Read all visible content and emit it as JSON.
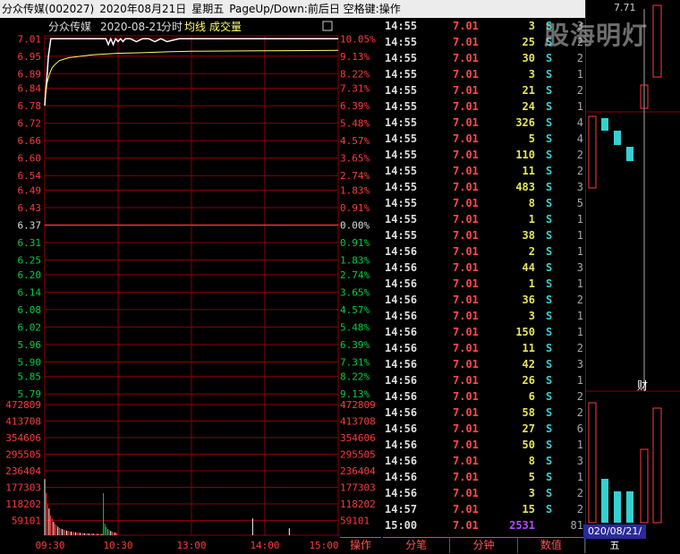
{
  "title_bar": {
    "stock": "分众传媒(002027)",
    "date": "2020年08月21日",
    "weekday": "星期五",
    "hint": "PageUp/Down:前后日 空格键:操作"
  },
  "chart_header": {
    "name": "分众传媒",
    "date": "2020-08-21",
    "mode": "分时",
    "avg_label": "均线",
    "vol_label": "成交量"
  },
  "chart_data": {
    "type": "line",
    "prev_close": 6.37,
    "price_ticks": [
      "7.01",
      "6.95",
      "6.89",
      "6.84",
      "6.78",
      "6.72",
      "6.66",
      "6.60",
      "6.54",
      "6.49",
      "6.43",
      "6.37",
      "6.31",
      "6.25",
      "6.20",
      "6.14",
      "6.08",
      "6.02",
      "5.96",
      "5.90",
      "5.85",
      "5.79"
    ],
    "pct_ticks": [
      "10.05%",
      "9.13%",
      "8.22%",
      "7.31%",
      "6.39%",
      "5.48%",
      "4.57%",
      "3.65%",
      "2.74%",
      "1.83%",
      "0.91%",
      "0.00%",
      "0.91%",
      "1.83%",
      "2.74%",
      "3.65%",
      "4.57%",
      "5.48%",
      "6.39%",
      "7.31%",
      "8.22%",
      "9.13%"
    ],
    "ylim": [
      5.76,
      7.02
    ],
    "price_series": {
      "x": [
        0,
        1,
        2,
        3,
        5,
        8,
        10,
        15,
        20,
        25,
        30,
        35,
        40,
        45,
        50,
        52,
        54,
        56,
        58,
        60,
        62,
        64,
        66,
        68,
        70,
        75,
        80,
        85,
        90,
        95,
        100,
        110,
        120,
        130,
        140,
        150,
        160,
        170,
        180,
        190,
        200,
        210,
        220,
        230,
        240
      ],
      "values": [
        6.78,
        6.84,
        6.89,
        6.95,
        7.01,
        7.01,
        7.01,
        7.01,
        7.01,
        7.01,
        7.01,
        7.01,
        7.01,
        7.01,
        7.01,
        6.99,
        7.01,
        6.99,
        7.01,
        7.0,
        7.01,
        7.0,
        7.01,
        7.01,
        7.01,
        7.0,
        7.01,
        7.01,
        7.0,
        7.01,
        7.0,
        7.01,
        7.01,
        7.01,
        7.01,
        7.01,
        7.01,
        7.01,
        7.01,
        7.01,
        7.01,
        7.01,
        7.01,
        7.01,
        7.01
      ]
    },
    "avg_series": {
      "x": [
        0,
        2,
        4,
        6,
        8,
        12,
        16,
        20,
        30,
        40,
        60,
        80,
        100,
        120,
        160,
        200,
        240
      ],
      "values": [
        6.8,
        6.86,
        6.89,
        6.91,
        6.92,
        6.935,
        6.94,
        6.945,
        6.95,
        6.955,
        6.96,
        6.962,
        6.965,
        6.967,
        6.968,
        6.969,
        6.97
      ]
    },
    "volume_ticks": [
      "472809",
      "413708",
      "354606",
      "295505",
      "236404",
      "177303",
      "118202",
      "59101"
    ],
    "volume_max": 472809,
    "volumes": [
      200000,
      150000,
      110000,
      95000,
      70000,
      60000,
      48000,
      40000,
      35000,
      30000,
      26000,
      24000,
      22000,
      20000,
      18000,
      16000,
      15000,
      14000,
      13000,
      12000,
      11000,
      10000,
      9500,
      9000,
      8500,
      8000,
      7500,
      7000,
      6800,
      6500,
      6200,
      6000,
      5800,
      5600,
      5400,
      5200,
      5000,
      4800,
      4600,
      4400,
      150000,
      40000,
      30000,
      22000,
      18000,
      15000,
      12000,
      10000,
      9000,
      8000
    ],
    "time_labels": [
      "09:30",
      "10:30",
      "13:00",
      "14:00",
      "15:00"
    ]
  },
  "ticks": [
    {
      "t": "14:55",
      "p": "7.01",
      "v": "3",
      "bs": "S",
      "n": "3"
    },
    {
      "t": "14:55",
      "p": "7.01",
      "v": "25",
      "bs": "S",
      "n": "2"
    },
    {
      "t": "14:55",
      "p": "7.01",
      "v": "30",
      "bs": "S",
      "n": "2"
    },
    {
      "t": "14:55",
      "p": "7.01",
      "v": "3",
      "bs": "S",
      "n": "1"
    },
    {
      "t": "14:55",
      "p": "7.01",
      "v": "21",
      "bs": "S",
      "n": "2"
    },
    {
      "t": "14:55",
      "p": "7.01",
      "v": "24",
      "bs": "S",
      "n": "1"
    },
    {
      "t": "14:55",
      "p": "7.01",
      "v": "326",
      "bs": "S",
      "n": "4"
    },
    {
      "t": "14:55",
      "p": "7.01",
      "v": "5",
      "bs": "S",
      "n": "4"
    },
    {
      "t": "14:55",
      "p": "7.01",
      "v": "110",
      "bs": "S",
      "n": "2"
    },
    {
      "t": "14:55",
      "p": "7.01",
      "v": "11",
      "bs": "S",
      "n": "2"
    },
    {
      "t": "14:55",
      "p": "7.01",
      "v": "483",
      "bs": "S",
      "n": "3"
    },
    {
      "t": "14:55",
      "p": "7.01",
      "v": "8",
      "bs": "S",
      "n": "5"
    },
    {
      "t": "14:55",
      "p": "7.01",
      "v": "1",
      "bs": "S",
      "n": "1"
    },
    {
      "t": "14:55",
      "p": "7.01",
      "v": "38",
      "bs": "S",
      "n": "1"
    },
    {
      "t": "14:56",
      "p": "7.01",
      "v": "2",
      "bs": "S",
      "n": "1"
    },
    {
      "t": "14:56",
      "p": "7.01",
      "v": "44",
      "bs": "S",
      "n": "3"
    },
    {
      "t": "14:56",
      "p": "7.01",
      "v": "1",
      "bs": "S",
      "n": "1"
    },
    {
      "t": "14:56",
      "p": "7.01",
      "v": "36",
      "bs": "S",
      "n": "2"
    },
    {
      "t": "14:56",
      "p": "7.01",
      "v": "3",
      "bs": "S",
      "n": "1"
    },
    {
      "t": "14:56",
      "p": "7.01",
      "v": "150",
      "bs": "S",
      "n": "1"
    },
    {
      "t": "14:56",
      "p": "7.01",
      "v": "11",
      "bs": "S",
      "n": "2"
    },
    {
      "t": "14:56",
      "p": "7.01",
      "v": "42",
      "bs": "S",
      "n": "3"
    },
    {
      "t": "14:56",
      "p": "7.01",
      "v": "26",
      "bs": "S",
      "n": "1"
    },
    {
      "t": "14:56",
      "p": "7.01",
      "v": "6",
      "bs": "S",
      "n": "2"
    },
    {
      "t": "14:56",
      "p": "7.01",
      "v": "58",
      "bs": "S",
      "n": "2"
    },
    {
      "t": "14:56",
      "p": "7.01",
      "v": "27",
      "bs": "S",
      "n": "6"
    },
    {
      "t": "14:56",
      "p": "7.01",
      "v": "50",
      "bs": "S",
      "n": "1"
    },
    {
      "t": "14:56",
      "p": "7.01",
      "v": "8",
      "bs": "S",
      "n": "3"
    },
    {
      "t": "14:56",
      "p": "7.01",
      "v": "5",
      "bs": "S",
      "n": "1"
    },
    {
      "t": "14:56",
      "p": "7.01",
      "v": "3",
      "bs": "S",
      "n": "2"
    },
    {
      "t": "14:57",
      "p": "7.01",
      "v": "15",
      "bs": "S",
      "n": "2"
    },
    {
      "t": "15:00",
      "p": "7.01",
      "v": "2531",
      "bs": "",
      "n": "81"
    }
  ],
  "tabs": [
    "分笔",
    "分钟",
    "数值"
  ],
  "left_tab": "操作",
  "kline": {
    "top_price": "7.71",
    "cai": "财",
    "date_label": "020/08/21/五"
  },
  "watermark": "股海明灯",
  "colors": {
    "up": "#ff3b3b",
    "down": "#00d0d0",
    "grid": "#8b0000",
    "price": "#ffffff",
    "avg": "#ffff66"
  }
}
